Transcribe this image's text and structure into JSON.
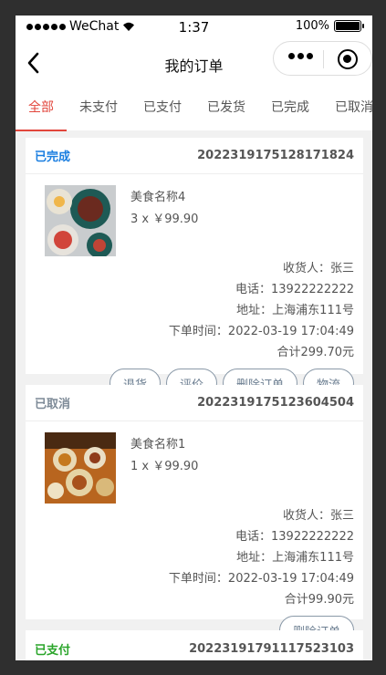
{
  "status_bar": {
    "carrier": "WeChat",
    "time": "1:37",
    "battery": "100%"
  },
  "nav": {
    "title": "我的订单"
  },
  "tabs": [
    "全部",
    "未支付",
    "已支付",
    "已发货",
    "已完成",
    "已取消"
  ],
  "orders": [
    {
      "status": "已完成",
      "status_color": "#1a7ee0",
      "order_no": "2022319175128171824",
      "item_name": "美食名称4",
      "item_qty": "3 x ￥99.90",
      "receiver": "收货人：张三",
      "phone": "电话：13922222222",
      "address": "地址：上海浦东111号",
      "time": "下单时间：2022-03-19 17:04:49",
      "total": "合计299.70元",
      "buttons": [
        "退货",
        "评价",
        "删除订单",
        "物流"
      ]
    },
    {
      "status": "已取消",
      "status_color": "#7d8a97",
      "order_no": "2022319175123604504",
      "item_name": "美食名称1",
      "item_qty": "1 x ￥99.90",
      "receiver": "收货人：张三",
      "phone": "电话：13922222222",
      "address": "地址：上海浦东111号",
      "time": "下单时间：2022-03-19 17:04:49",
      "total": "合计99.90元",
      "buttons": [
        "删除订单"
      ]
    },
    {
      "status": "已支付",
      "status_color": "#2aa52a",
      "order_no": "2022319179111752310​3"
    }
  ],
  "colors": {
    "accent": "#e2463c"
  }
}
